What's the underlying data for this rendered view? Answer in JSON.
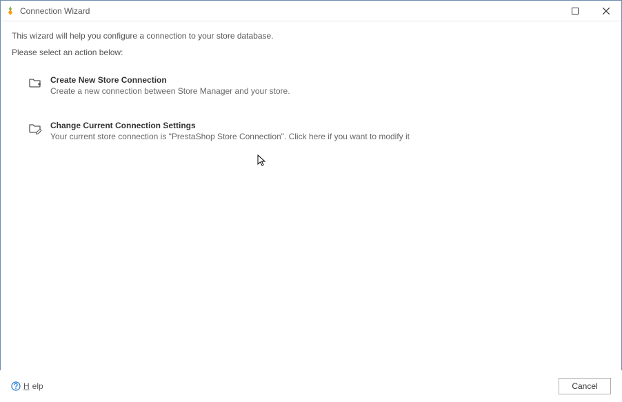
{
  "titlebar": {
    "title": "Connection Wizard"
  },
  "content": {
    "intro": "This wizard will help you configure a connection to your store database.",
    "instruction": "Please select an action below:",
    "options": [
      {
        "title": "Create New Store Connection",
        "description": "Create a new connection between Store Manager and your store."
      },
      {
        "title": "Change Current Connection Settings",
        "description": "Your current store connection is \"PrestaShop Store Connection\". Click here if you want to modify it"
      }
    ]
  },
  "footer": {
    "help_label": "Help",
    "cancel_label": "Cancel"
  }
}
